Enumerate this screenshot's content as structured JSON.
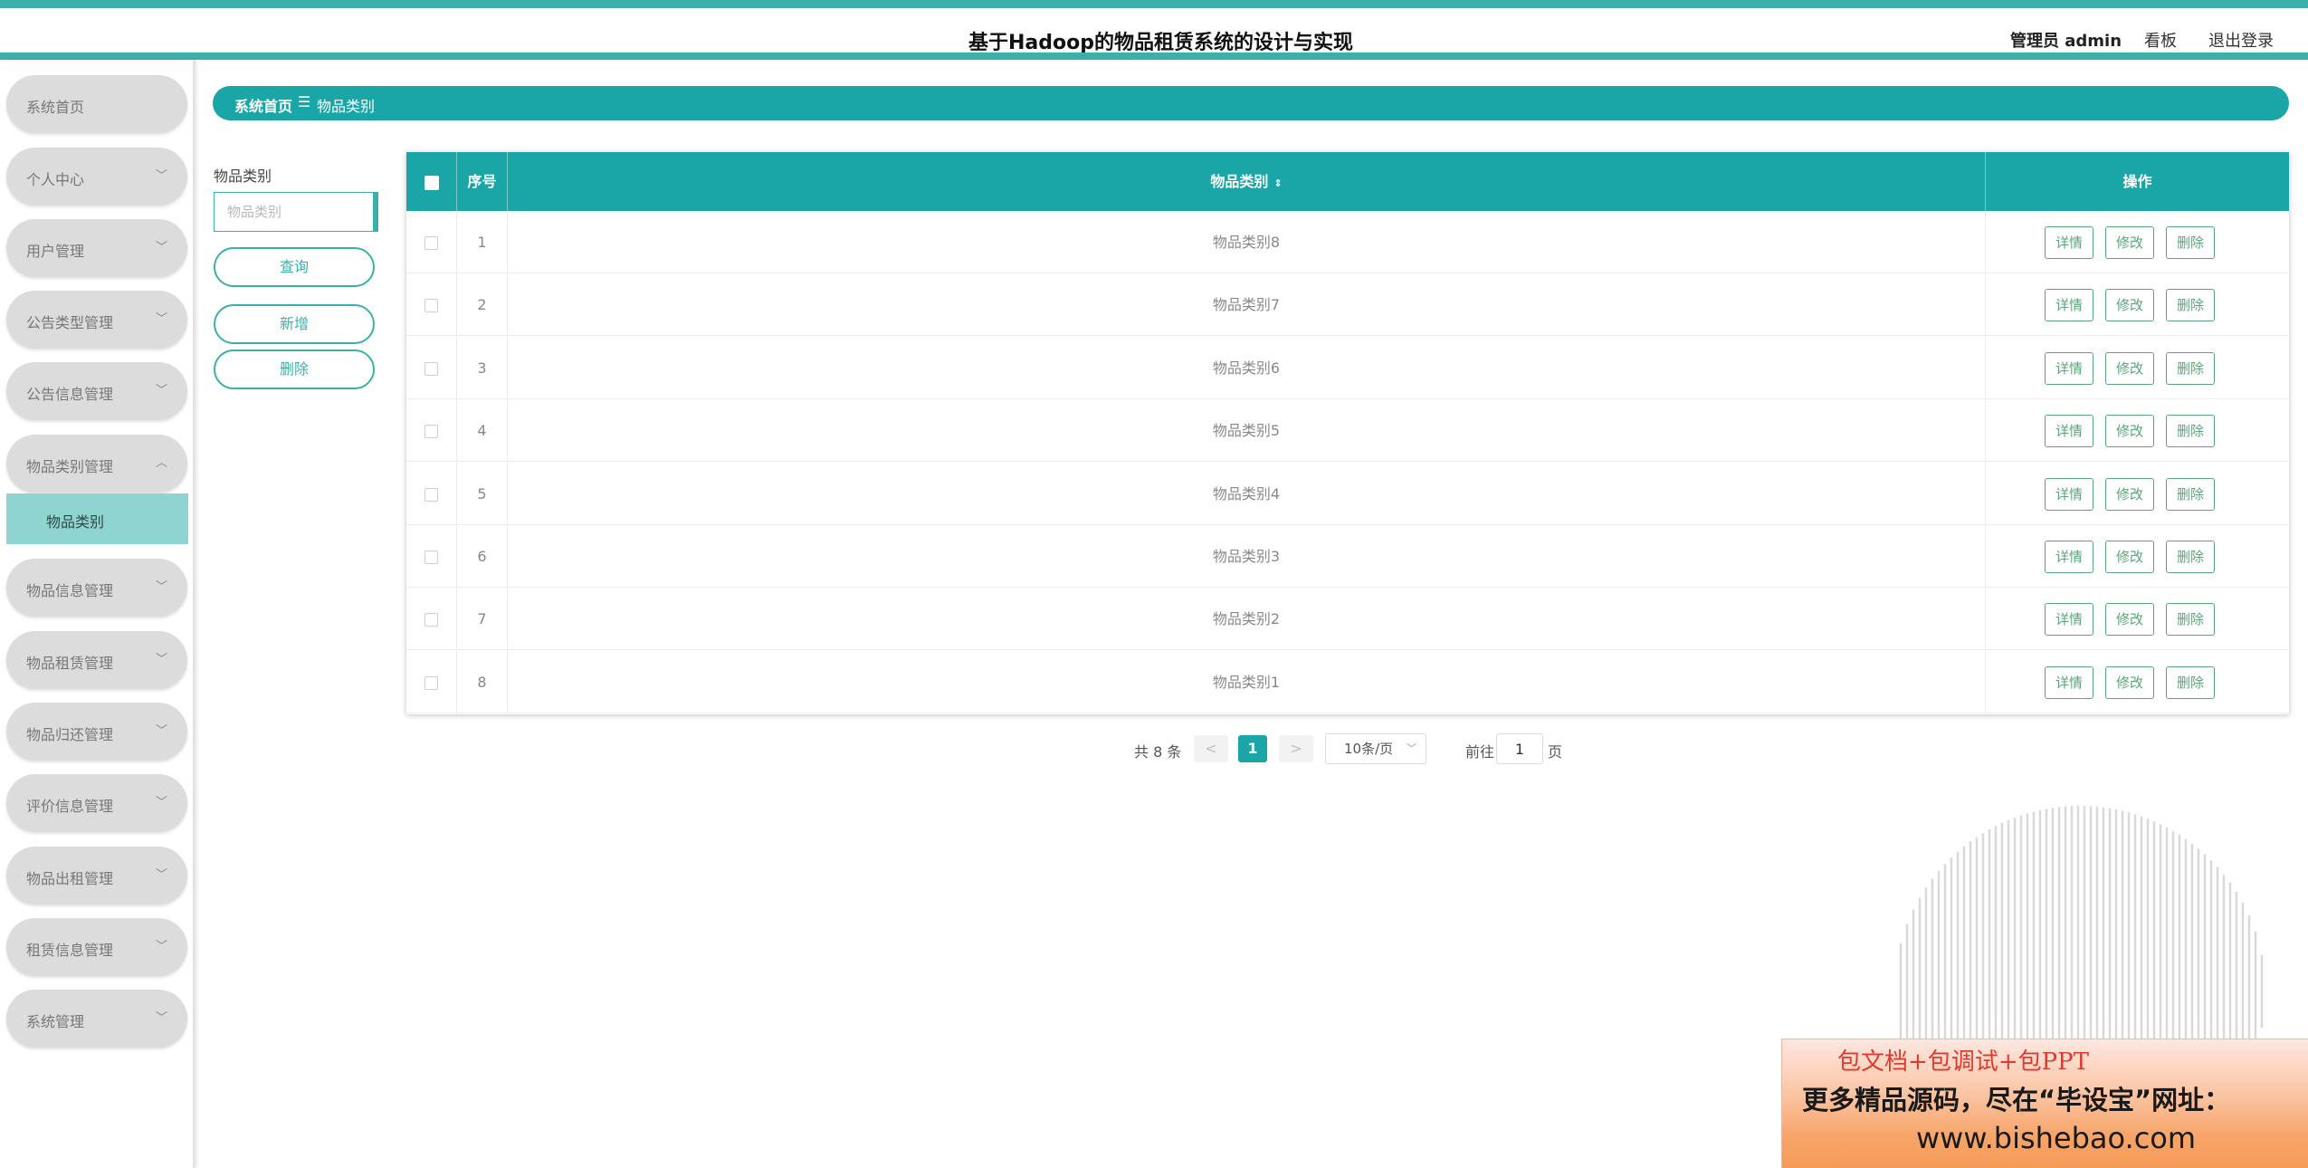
{
  "header": {
    "title": "基于Hadoop的物品租赁系统的设计与实现",
    "user": "管理员 admin",
    "board": "看板",
    "logout": "退出登录"
  },
  "sidebar": {
    "items": [
      {
        "label": "系统首页",
        "has_chevron": false
      },
      {
        "label": "个人中心",
        "has_chevron": true
      },
      {
        "label": "用户管理",
        "has_chevron": true
      },
      {
        "label": "公告类型管理",
        "has_chevron": true
      },
      {
        "label": "公告信息管理",
        "has_chevron": true
      },
      {
        "label": "物品类别管理",
        "has_chevron": true,
        "expanded": true
      },
      {
        "label": "物品信息管理",
        "has_chevron": true
      },
      {
        "label": "物品租赁管理",
        "has_chevron": true
      },
      {
        "label": "物品归还管理",
        "has_chevron": true
      },
      {
        "label": "评价信息管理",
        "has_chevron": true
      },
      {
        "label": "物品出租管理",
        "has_chevron": true
      },
      {
        "label": "租赁信息管理",
        "has_chevron": true
      },
      {
        "label": "系统管理",
        "has_chevron": true
      }
    ],
    "active_subitem": "物品类别"
  },
  "breadcrumb": {
    "home": "系统首页",
    "separator": "☰",
    "current": "物品类别"
  },
  "search": {
    "label": "物品类别",
    "placeholder": "物品类别",
    "value": "",
    "query_button": "查询",
    "add_button": "新增",
    "delete_button": "删除"
  },
  "table": {
    "headers": {
      "index": "序号",
      "category": "物品类别",
      "actions": "操作"
    },
    "action_labels": {
      "detail": "详情",
      "edit": "修改",
      "delete": "删除"
    },
    "rows": [
      {
        "index": "1",
        "category": "物品类别8"
      },
      {
        "index": "2",
        "category": "物品类别7"
      },
      {
        "index": "3",
        "category": "物品类别6"
      },
      {
        "index": "4",
        "category": "物品类别5"
      },
      {
        "index": "5",
        "category": "物品类别4"
      },
      {
        "index": "6",
        "category": "物品类别3"
      },
      {
        "index": "7",
        "category": "物品类别2"
      },
      {
        "index": "8",
        "category": "物品类别1"
      }
    ]
  },
  "pagination": {
    "total_text": "共 8 条",
    "prev": "<",
    "current_page": "1",
    "next": ">",
    "page_size": "10条/页",
    "goto_label": "前往",
    "goto_value": "1",
    "page_suffix": "页"
  },
  "ad": {
    "line1": "包文档+包调试+包PPT",
    "line2": "更多精品源码，尽在“毕设宝”网址：",
    "line3": "www.bishebao.com"
  },
  "colors": {
    "primary": "#1aa6a6",
    "accent_bar": "#3bb0aa",
    "action_button": "#5aa57a",
    "submenu_active": "#8fd4d0"
  }
}
